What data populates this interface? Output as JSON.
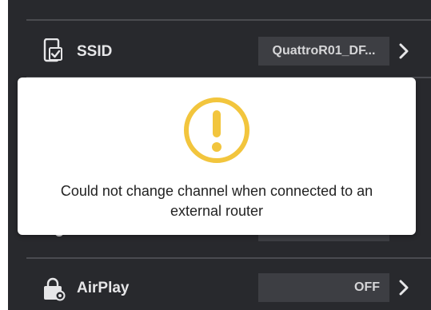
{
  "settings": {
    "ssid": {
      "label": "SSID",
      "value": "QuattroR01_DF...",
      "icon": "phone-check-icon"
    },
    "airplay": {
      "label": "AirPlay",
      "value": "OFF",
      "icon": "airplay-lock-icon"
    }
  },
  "alert": {
    "icon": "warning-circle-icon",
    "icon_color": "#f2c53d",
    "message": "Could not change channel when connected to an external router"
  },
  "colors": {
    "background": "#28292d",
    "value_box": "#3d3e43",
    "text": "#e6e6e8"
  }
}
